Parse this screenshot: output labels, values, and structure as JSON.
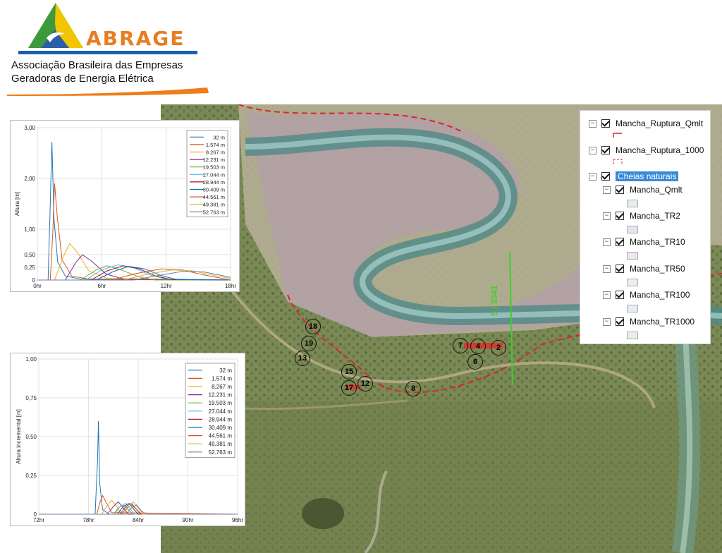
{
  "header": {
    "brand": "ABRAGE",
    "org_line1": "Associação Brasileira das Empresas",
    "org_line2": "Geradoras de Energia Elétrica"
  },
  "map": {
    "section_label": "5 | 3341",
    "points": [
      "18",
      "19",
      "13",
      "15",
      "17",
      "12",
      "8",
      "7",
      "4",
      "2",
      "6"
    ]
  },
  "legend": {
    "items": [
      {
        "label": "Mancha_Ruptura_Qmlt",
        "checked": true,
        "swatch": "red-dash-line"
      },
      {
        "label": "Mancha_Ruptura_1000",
        "checked": true,
        "swatch": "red-dash-box"
      },
      {
        "label": "Cheias naturais",
        "checked": true,
        "selected": true,
        "group": true
      },
      {
        "label": "Mancha_Qmlt",
        "checked": true,
        "swatch_color": "#e6efe3"
      },
      {
        "label": "Mancha_TR2",
        "checked": true,
        "swatch_color": "#e9e3ef"
      },
      {
        "label": "Mancha_TR10",
        "checked": true,
        "swatch_color": "#f1e4ee"
      },
      {
        "label": "Mancha_TR50",
        "checked": true,
        "swatch_color": "#efefe3"
      },
      {
        "label": "Mancha_TR100",
        "checked": true,
        "swatch_color": "#e7eef3"
      },
      {
        "label": "Mancha_TR1000",
        "checked": true,
        "swatch_color": "#e7f0e3"
      }
    ]
  },
  "chart_data": [
    {
      "type": "line",
      "title": "",
      "xlabel": "",
      "ylabel": "Altura [m]",
      "xlim": [
        0,
        18
      ],
      "ylim": [
        0,
        3.0
      ],
      "x_ticks": [
        "0hr",
        "6hr",
        "12hr",
        "18hr"
      ],
      "y_ticks": [
        "0",
        "0,25",
        "0,50",
        "1,00",
        "2,00",
        "3,00"
      ],
      "y_tick_values": [
        0,
        0.25,
        0.5,
        1.0,
        2.0,
        3.0
      ],
      "grid": true,
      "legend_position": "top-right",
      "series": [
        {
          "name": "32 m",
          "color": "#1f77b4",
          "values": [
            [
              0,
              0
            ],
            [
              1.0,
              0
            ],
            [
              1.2,
              1.5
            ],
            [
              1.35,
              2.72
            ],
            [
              1.55,
              1.2
            ],
            [
              1.9,
              0.35
            ],
            [
              2.6,
              0.08
            ],
            [
              4,
              0.02
            ],
            [
              18,
              0
            ]
          ]
        },
        {
          "name": "1.574 m",
          "color": "#d95319",
          "values": [
            [
              0,
              0
            ],
            [
              1.2,
              0
            ],
            [
              1.45,
              1.0
            ],
            [
              1.6,
              1.9
            ],
            [
              1.85,
              1.25
            ],
            [
              2.3,
              0.4
            ],
            [
              3.2,
              0.08
            ],
            [
              5,
              0.01
            ],
            [
              18,
              0
            ]
          ]
        },
        {
          "name": "8.267 m",
          "color": "#edb120",
          "values": [
            [
              0,
              0
            ],
            [
              1.6,
              0
            ],
            [
              2.4,
              0.45
            ],
            [
              3.0,
              0.72
            ],
            [
              3.7,
              0.55
            ],
            [
              4.8,
              0.18
            ],
            [
              6.5,
              0.03
            ],
            [
              18,
              0
            ]
          ]
        },
        {
          "name": "12.231 m",
          "color": "#7e2f8e",
          "values": [
            [
              0,
              0
            ],
            [
              2.6,
              0
            ],
            [
              3.6,
              0.35
            ],
            [
              4.2,
              0.5
            ],
            [
              5.0,
              0.38
            ],
            [
              6.4,
              0.12
            ],
            [
              8,
              0.02
            ],
            [
              18,
              0
            ]
          ]
        },
        {
          "name": "19.503 m",
          "color": "#77ac30",
          "values": [
            [
              0,
              0
            ],
            [
              4,
              0
            ],
            [
              5.5,
              0.2
            ],
            [
              6.5,
              0.28
            ],
            [
              7.8,
              0.2
            ],
            [
              9.5,
              0.06
            ],
            [
              11,
              0
            ],
            [
              18,
              0
            ]
          ]
        },
        {
          "name": "27.044 m",
          "color": "#4dbeee",
          "values": [
            [
              0,
              0
            ],
            [
              4.5,
              0
            ],
            [
              6,
              0.2
            ],
            [
              7.5,
              0.3
            ],
            [
              9,
              0.24
            ],
            [
              10.5,
              0.1
            ],
            [
              12,
              0.02
            ],
            [
              18,
              0
            ]
          ]
        },
        {
          "name": "28.944 m",
          "color": "#a2142f",
          "values": [
            [
              0,
              0
            ],
            [
              5,
              0
            ],
            [
              6.5,
              0.18
            ],
            [
              8,
              0.28
            ],
            [
              9.5,
              0.22
            ],
            [
              11,
              0.08
            ],
            [
              12.5,
              0.01
            ],
            [
              18,
              0
            ]
          ]
        },
        {
          "name": "30.409 m",
          "color": "#0072bd",
          "values": [
            [
              0,
              0
            ],
            [
              5.5,
              0
            ],
            [
              7,
              0.16
            ],
            [
              8.5,
              0.27
            ],
            [
              10,
              0.22
            ],
            [
              11.5,
              0.09
            ],
            [
              13,
              0.01
            ],
            [
              18,
              0
            ]
          ]
        },
        {
          "name": "44.561 m",
          "color": "#d9531e",
          "values": [
            [
              0,
              0
            ],
            [
              7,
              0
            ],
            [
              9,
              0.12
            ],
            [
              11.5,
              0.22
            ],
            [
              13.5,
              0.2
            ],
            [
              15.5,
              0.1
            ],
            [
              17.5,
              0.02
            ],
            [
              18,
              0
            ]
          ]
        },
        {
          "name": "49.381 m",
          "color": "#d6b43a",
          "values": [
            [
              0,
              0
            ],
            [
              8,
              0
            ],
            [
              10,
              0.1
            ],
            [
              12.5,
              0.2
            ],
            [
              14.5,
              0.18
            ],
            [
              16.5,
              0.09
            ],
            [
              18,
              0.03
            ]
          ]
        },
        {
          "name": "52.763 m",
          "color": "#6d7fa6",
          "values": [
            [
              0,
              0
            ],
            [
              9,
              0
            ],
            [
              11,
              0.08
            ],
            [
              13.5,
              0.17
            ],
            [
              15.5,
              0.16
            ],
            [
              17.2,
              0.09
            ],
            [
              18,
              0.05
            ]
          ]
        }
      ]
    },
    {
      "type": "line",
      "title": "",
      "xlabel": "",
      "ylabel": "Altura incremental [m]",
      "xlim": [
        72,
        96
      ],
      "ylim": [
        0,
        1.0
      ],
      "x_ticks": [
        "72hr",
        "78hr",
        "84hr",
        "90hr",
        "96hr"
      ],
      "x_tick_values": [
        72,
        78,
        84,
        90,
        96
      ],
      "y_ticks": [
        "0",
        "0,25",
        "0,50",
        "0,75",
        "1,00"
      ],
      "y_tick_values": [
        0,
        0.25,
        0.5,
        0.75,
        1.0
      ],
      "grid": true,
      "legend_position": "top-right",
      "series": [
        {
          "name": "32 m",
          "color": "#1f77b4",
          "values": [
            [
              72,
              0
            ],
            [
              78.8,
              0
            ],
            [
              79.1,
              0.35
            ],
            [
              79.2,
              0.6
            ],
            [
              79.35,
              0.2
            ],
            [
              79.7,
              0.03
            ],
            [
              80.5,
              0
            ],
            [
              96,
              0
            ]
          ]
        },
        {
          "name": "1.574 m",
          "color": "#d95319",
          "values": [
            [
              72,
              0
            ],
            [
              79.0,
              0
            ],
            [
              79.4,
              0.08
            ],
            [
              79.7,
              0.12
            ],
            [
              80.2,
              0.07
            ],
            [
              80.8,
              0.01
            ],
            [
              96,
              0
            ]
          ]
        },
        {
          "name": "8.267 m",
          "color": "#edb120",
          "values": [
            [
              72,
              0
            ],
            [
              79.6,
              0
            ],
            [
              80.3,
              0.06
            ],
            [
              80.8,
              0.09
            ],
            [
              81.4,
              0.05
            ],
            [
              82,
              0
            ],
            [
              96,
              0
            ]
          ]
        },
        {
          "name": "12.231 m",
          "color": "#7e2f8e",
          "values": [
            [
              72,
              0
            ],
            [
              80.3,
              0
            ],
            [
              81,
              0.05
            ],
            [
              81.6,
              0.08
            ],
            [
              82.2,
              0.04
            ],
            [
              82.8,
              0
            ],
            [
              96,
              0
            ]
          ]
        },
        {
          "name": "19.503 m",
          "color": "#77ac30",
          "values": [
            [
              72,
              0
            ],
            [
              81,
              0
            ],
            [
              81.6,
              0.04
            ],
            [
              82.2,
              0.06
            ],
            [
              82.8,
              0.03
            ],
            [
              83.4,
              0
            ],
            [
              96,
              0
            ]
          ]
        },
        {
          "name": "27.044 m",
          "color": "#4dbeee",
          "values": [
            [
              72,
              0
            ],
            [
              81.2,
              0
            ],
            [
              81.8,
              0.05
            ],
            [
              82.5,
              0.07
            ],
            [
              83.1,
              0.03
            ],
            [
              83.6,
              0
            ],
            [
              96,
              0
            ]
          ]
        },
        {
          "name": "28.944 m",
          "color": "#a2142f",
          "values": [
            [
              72,
              0
            ],
            [
              81.5,
              0
            ],
            [
              82.2,
              0.05
            ],
            [
              82.9,
              0.07
            ],
            [
              83.5,
              0.03
            ],
            [
              84,
              0
            ],
            [
              96,
              0
            ]
          ]
        },
        {
          "name": "30.409 m",
          "color": "#0072bd",
          "values": [
            [
              72,
              0
            ],
            [
              81.8,
              0
            ],
            [
              82.5,
              0.05
            ],
            [
              83.2,
              0.07
            ],
            [
              83.8,
              0.03
            ],
            [
              84.3,
              0
            ],
            [
              96,
              0
            ]
          ]
        },
        {
          "name": "44.561 m",
          "color": "#d9531e",
          "values": [
            [
              72,
              0
            ],
            [
              82,
              0
            ],
            [
              82.6,
              0.04
            ],
            [
              83.2,
              0.06
            ],
            [
              83.8,
              0.03
            ],
            [
              84.4,
              0
            ],
            [
              96,
              0
            ]
          ]
        },
        {
          "name": "49.381 m",
          "color": "#d6b43a",
          "values": [
            [
              72,
              0
            ],
            [
              82.2,
              0
            ],
            [
              82.9,
              0.05
            ],
            [
              83.4,
              0.08
            ],
            [
              84.0,
              0.04
            ],
            [
              84.6,
              0
            ],
            [
              96,
              0
            ]
          ]
        },
        {
          "name": "52.763 m",
          "color": "#6d7fa6",
          "values": [
            [
              72,
              0
            ],
            [
              82.5,
              0
            ],
            [
              83.2,
              0.04
            ],
            [
              83.8,
              0.06
            ],
            [
              84.4,
              0.02
            ],
            [
              85,
              0
            ],
            [
              96,
              0
            ]
          ]
        }
      ]
    }
  ]
}
